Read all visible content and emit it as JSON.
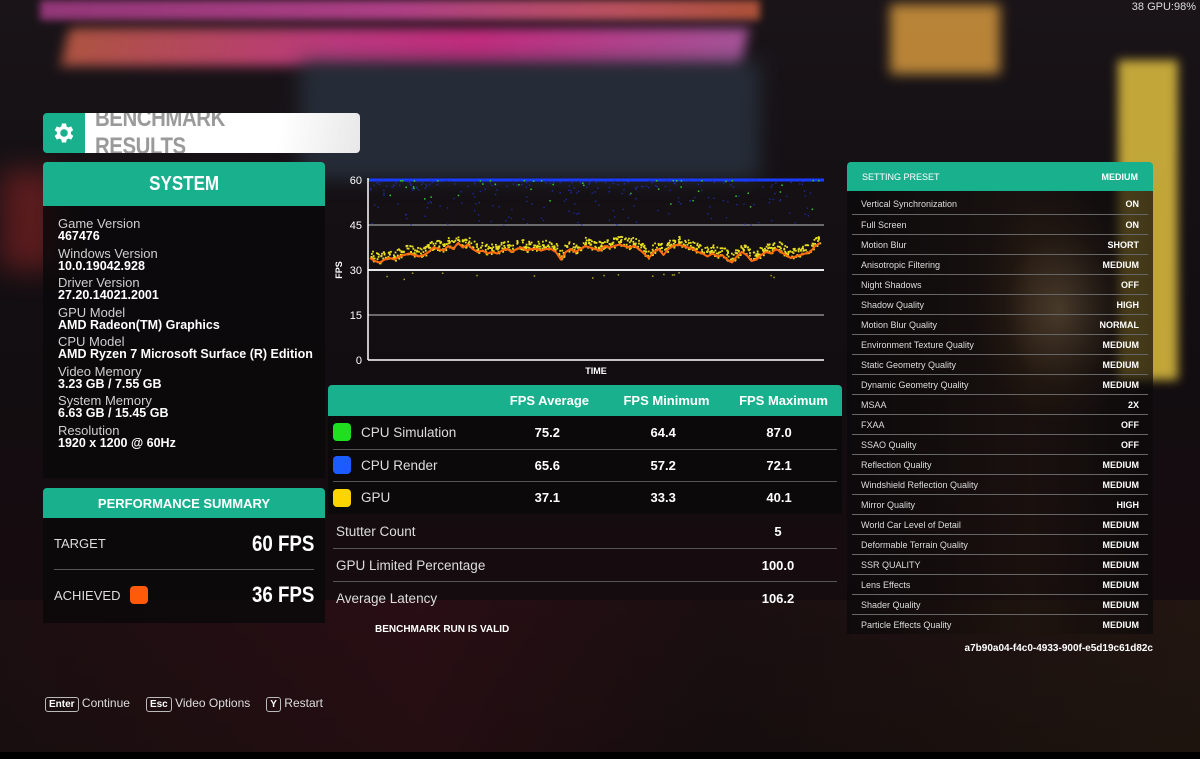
{
  "overlay": {
    "stats": "38 GPU:98%"
  },
  "title": {
    "text": "BENCHMARK RESULTS",
    "icon": "gear-icon"
  },
  "colors": {
    "accent": "#19b08e",
    "cpu_sim": "#1fe01f",
    "cpu_render": "#1a5cff",
    "gpu": "#ffd400",
    "achieved": "#ff5a0a"
  },
  "system": {
    "header": "SYSTEM",
    "items": [
      {
        "label": "Game Version",
        "value": "467476"
      },
      {
        "label": "Windows Version",
        "value": "10.0.19042.928"
      },
      {
        "label": "Driver Version",
        "value": "27.20.14021.2001"
      },
      {
        "label": "GPU Model",
        "value": "AMD Radeon(TM) Graphics"
      },
      {
        "label": "CPU Model",
        "value": "AMD Ryzen 7 Microsoft Surface (R) Edition"
      },
      {
        "label": "Video Memory",
        "value": "3.23 GB / 7.55 GB"
      },
      {
        "label": "System Memory",
        "value": "6.63 GB / 15.45 GB"
      },
      {
        "label": "Resolution",
        "value": "1920 x 1200 @ 60Hz"
      }
    ]
  },
  "performance": {
    "header": "PERFORMANCE SUMMARY",
    "target_label": "TARGET",
    "target_value": "60 FPS",
    "achieved_label": "ACHIEVED",
    "achieved_value": "36 FPS"
  },
  "chart_data": {
    "type": "scatter",
    "title": "",
    "xlabel": "TIME",
    "ylabel": "FPS",
    "ylim": [
      0,
      60
    ],
    "yticks": [
      "0",
      "15",
      "30",
      "45",
      "60"
    ],
    "grid": true,
    "series": [
      {
        "name": "CPU Render",
        "color": "#1a3cff",
        "mean": 60,
        "note": "capped near 60 with scattered dips to ~45"
      },
      {
        "name": "CPU Simulation",
        "color": "#2fd02f",
        "mean": 60,
        "note": "capped near 60 with sparse dips to ~50"
      },
      {
        "name": "GPU",
        "color": "#e8e020",
        "mean": 37.1,
        "note": "scatter band ~33-41"
      },
      {
        "name": "Achieved (smoothed)",
        "color": "#ff6a10",
        "values": [
          34,
          33,
          32.5,
          33.5,
          34,
          33.5,
          34.5,
          35,
          35.5,
          35,
          34.5,
          35,
          36,
          37.5,
          37,
          36.5,
          38,
          37,
          39,
          37.5,
          38.5,
          37,
          36,
          36.5,
          35.5,
          36,
          35.5,
          36.5,
          37,
          36,
          37,
          37.5,
          36.5,
          37,
          37,
          36.5,
          37,
          37,
          36,
          33.5,
          36,
          37,
          36,
          37,
          38,
          37.5,
          37,
          36.5,
          38,
          37.5,
          38,
          38.5,
          38,
          37.5,
          38,
          37,
          35.5,
          34,
          36,
          37,
          35,
          37,
          38,
          38.5,
          38,
          37.5,
          37,
          36,
          35.5,
          34.5,
          35.5,
          34.5,
          35,
          33.5,
          32.5,
          34.5,
          36,
          35,
          33,
          33.5,
          35,
          36,
          35.5,
          37,
          36,
          35,
          34,
          34.5,
          35,
          35.5,
          36,
          38,
          39
        ]
      }
    ]
  },
  "fps_table": {
    "columns": [
      "",
      "FPS Average",
      "FPS Minimum",
      "FPS Maximum"
    ],
    "rows": [
      {
        "name": "CPU Simulation",
        "avg": "75.2",
        "min": "64.4",
        "max": "87.0"
      },
      {
        "name": "CPU Render",
        "avg": "65.6",
        "min": "57.2",
        "max": "72.1"
      },
      {
        "name": "GPU",
        "avg": "37.1",
        "min": "33.3",
        "max": "40.1"
      }
    ]
  },
  "extras": [
    {
      "label": "Stutter Count",
      "value": "5"
    },
    {
      "label": "GPU Limited Percentage",
      "value": "100.0"
    },
    {
      "label": "Average Latency",
      "value": "106.2"
    }
  ],
  "valid_text": "BENCHMARK RUN IS VALID",
  "settings": {
    "header_label": "SETTING PRESET",
    "header_value": "MEDIUM",
    "rows": [
      {
        "label": "Vertical Synchronization",
        "value": "ON"
      },
      {
        "label": "Full Screen",
        "value": "ON"
      },
      {
        "label": "Motion Blur",
        "value": "SHORT"
      },
      {
        "label": "Anisotropic Filtering",
        "value": "MEDIUM"
      },
      {
        "label": "Night Shadows",
        "value": "OFF"
      },
      {
        "label": "Shadow Quality",
        "value": "HIGH"
      },
      {
        "label": "Motion Blur Quality",
        "value": "NORMAL"
      },
      {
        "label": "Environment Texture Quality",
        "value": "MEDIUM"
      },
      {
        "label": "Static Geometry Quality",
        "value": "MEDIUM"
      },
      {
        "label": "Dynamic Geometry Quality",
        "value": "MEDIUM"
      },
      {
        "label": "MSAA",
        "value": "2X"
      },
      {
        "label": "FXAA",
        "value": "OFF"
      },
      {
        "label": "SSAO Quality",
        "value": "OFF"
      },
      {
        "label": "Reflection Quality",
        "value": "MEDIUM"
      },
      {
        "label": "Windshield Reflection Quality",
        "value": "MEDIUM"
      },
      {
        "label": "Mirror Quality",
        "value": "HIGH"
      },
      {
        "label": "World Car Level of Detail",
        "value": "MEDIUM"
      },
      {
        "label": "Deformable Terrain Quality",
        "value": "MEDIUM"
      },
      {
        "label": "SSR QUALITY",
        "value": "MEDIUM"
      },
      {
        "label": "Lens Effects",
        "value": "MEDIUM"
      },
      {
        "label": "Shader Quality",
        "value": "MEDIUM"
      },
      {
        "label": "Particle Effects Quality",
        "value": "MEDIUM"
      }
    ],
    "hash": "a7b90a04-f4c0-4933-900f-e5d19c61d82c"
  },
  "footer": [
    {
      "key": "Enter",
      "label": "Continue"
    },
    {
      "key": "Esc",
      "label": "Video Options"
    },
    {
      "key": "Y",
      "label": "Restart"
    }
  ]
}
